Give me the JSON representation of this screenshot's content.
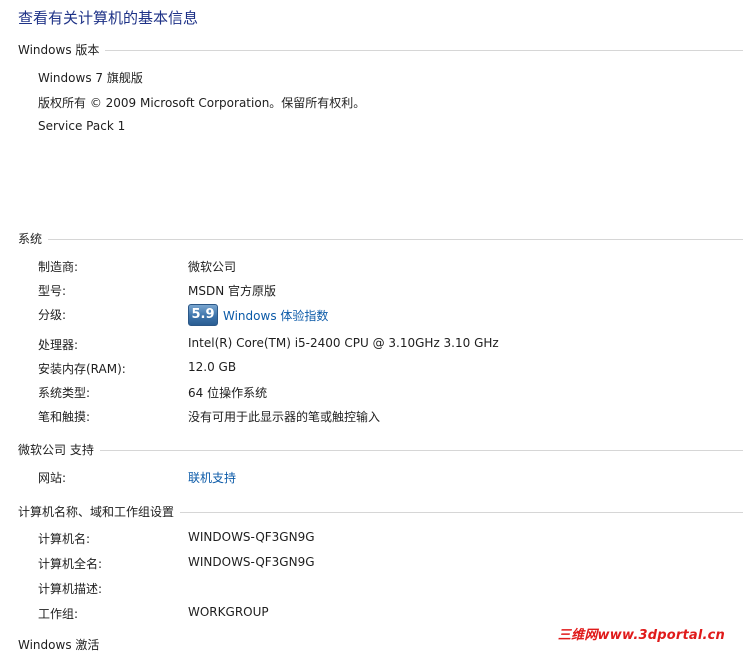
{
  "page_title": "查看有关计算机的基本信息",
  "windows_edition": {
    "heading": "Windows 版本",
    "edition": "Windows 7 旗舰版",
    "copyright": "版权所有 © 2009 Microsoft Corporation。保留所有权利。",
    "service_pack": "Service Pack 1"
  },
  "system": {
    "heading": "系统",
    "manufacturer_label": "制造商:",
    "manufacturer_value": "微软公司",
    "model_label": "型号:",
    "model_value": "MSDN 官方原版",
    "rating_label": "分级:",
    "rating_score": "5.9",
    "rating_link": "Windows 体验指数",
    "processor_label": "处理器:",
    "processor_value": "Intel(R) Core(TM) i5-2400 CPU @ 3.10GHz   3.10 GHz",
    "ram_label": "安装内存(RAM):",
    "ram_value": "12.0 GB",
    "type_label": "系统类型:",
    "type_value": "64 位操作系统",
    "pen_label": "笔和触摸:",
    "pen_value": "没有可用于此显示器的笔或触控输入"
  },
  "support": {
    "heading": "微软公司 支持",
    "website_label": "网站:",
    "website_link": "联机支持"
  },
  "computer_name": {
    "heading": "计算机名称、域和工作组设置",
    "name_label": "计算机名:",
    "name_value": "WINDOWS-QF3GN9G",
    "full_name_label": "计算机全名:",
    "full_name_value": "WINDOWS-QF3GN9G",
    "description_label": "计算机描述:",
    "workgroup_label": "工作组:",
    "workgroup_value": "WORKGROUP"
  },
  "next_section_heading_partial": "Windows 激活",
  "watermark": "三维网www.3dportal.cn",
  "colors": {
    "title": "#1e3287",
    "link": "#0b5aa8",
    "watermark": "#e01a1a"
  }
}
